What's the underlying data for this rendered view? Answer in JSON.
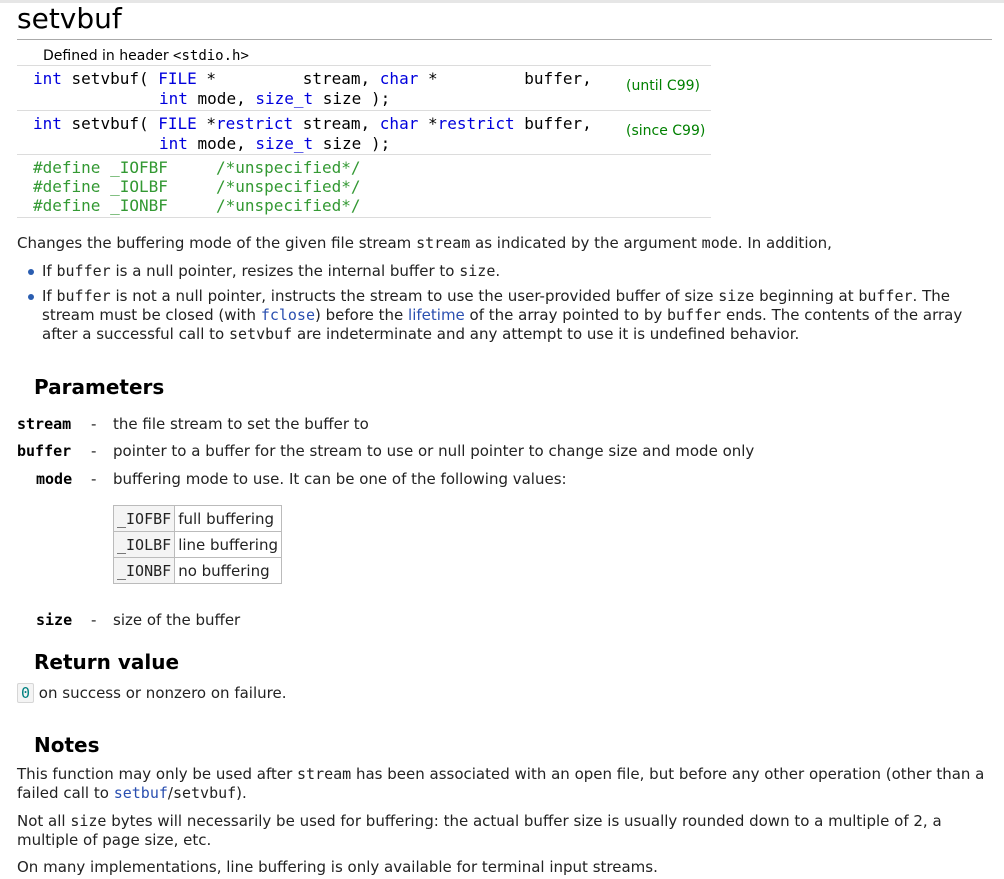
{
  "page": {
    "title": "setvbuf"
  },
  "declarations": {
    "header_prefix": "Defined in header ",
    "header_name": "<stdio.h>",
    "sig1": {
      "line1": {
        "t_int": "int",
        "fn": " setvbuf( ",
        "t_file": "FILE",
        "p1": " *         stream, ",
        "t_char": "char",
        "p2": " *         buffer,"
      },
      "line2": {
        "t_int": "int",
        "p1": " mode, ",
        "t_size": "size_t",
        "p2": " size );"
      },
      "version": "(until C99)"
    },
    "sig2": {
      "line1": {
        "t_int": "int",
        "fn": " setvbuf( ",
        "t_file": "FILE",
        "p1": " *",
        "kw_restrict1": "restrict",
        "p2": " stream, ",
        "t_char": "char",
        "p3": " *",
        "kw_restrict2": "restrict",
        "p4": " buffer,"
      },
      "line2": {
        "t_int": "int",
        "p1": " mode, ",
        "t_size": "size_t",
        "p2": " size );"
      },
      "version": "(since C99)"
    },
    "defines": [
      {
        "directive": "#define _IOFBF",
        "comment": "/*unspecified*/"
      },
      {
        "directive": "#define _IOLBF",
        "comment": "/*unspecified*/"
      },
      {
        "directive": "#define _IONBF",
        "comment": "/*unspecified*/"
      }
    ]
  },
  "intro": {
    "t1": "Changes the buffering mode of the given file stream ",
    "c1": "stream",
    "t2": " as indicated by the argument ",
    "c2": "mode",
    "t3": ". In addition,"
  },
  "bullets": {
    "b1": {
      "t1": "If ",
      "c1": "buffer",
      "t2": " is a null pointer, resizes the internal buffer to ",
      "c2": "size",
      "t3": "."
    },
    "b2": {
      "t1": "If ",
      "c1": "buffer",
      "t2": " is not a null pointer, instructs the stream to use the user-provided buffer of size ",
      "c2": "size",
      "t3": " beginning at ",
      "c3": "buffer",
      "t4": ". The stream must be closed (with ",
      "link1": "fclose",
      "t5": ") before the ",
      "link2": "lifetime",
      "t6": " of the array pointed to by ",
      "c4": "buffer",
      "t7": " ends. The contents of the array after a successful call to ",
      "c5": "setvbuf",
      "t8": " are indeterminate and any attempt to use it is undefined behavior."
    }
  },
  "parameters": {
    "heading": "Parameters",
    "dash": "-",
    "stream": {
      "name": "stream",
      "desc": "the file stream to set the buffer to"
    },
    "buffer": {
      "name": "buffer",
      "desc": "pointer to a buffer for the stream to use or null pointer to change size and mode only"
    },
    "mode": {
      "name": "mode",
      "desc": "buffering mode to use. It can be one of the following values:"
    },
    "mode_values": [
      {
        "code": "_IOFBF",
        "desc": "full buffering"
      },
      {
        "code": "_IOLBF",
        "desc": "line buffering"
      },
      {
        "code": "_IONBF",
        "desc": "no buffering"
      }
    ],
    "size": {
      "name": "size",
      "desc": "size of the buffer"
    }
  },
  "return_value": {
    "heading": "Return value",
    "zero": "0",
    "text": " on success or nonzero on failure."
  },
  "notes": {
    "heading": "Notes",
    "n1": {
      "t1": "This function may only be used after ",
      "c1": "stream",
      "t2": " has been associated with an open file, but before any other operation (other than a failed call to ",
      "link1": "setbuf",
      "t3": "/",
      "c2": "setvbuf",
      "t4": ")."
    },
    "n2": {
      "t1": "Not all ",
      "c1": "size",
      "t2": " bytes will necessarily be used for buffering: the actual buffer size is usually rounded down to a multiple of 2, a multiple of page size, etc."
    },
    "n3": "On many implementations, line buffering is only available for terminal input streams."
  }
}
